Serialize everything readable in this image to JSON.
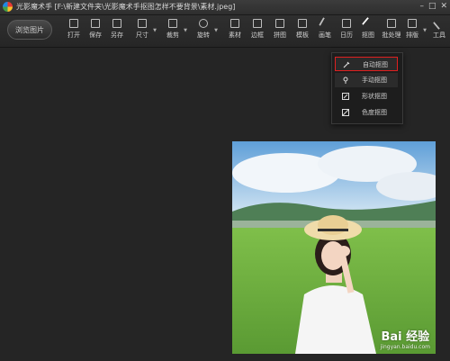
{
  "titlebar": {
    "title": "光影魔术手 [F:\\新建文件夹\\光影魔术手抠图怎样不要背景\\素材.jpeg]"
  },
  "toolbar": {
    "browse_label": "浏览图片",
    "tools": [
      {
        "label": "打开",
        "icon": "open-icon"
      },
      {
        "label": "保存",
        "icon": "save-icon"
      },
      {
        "label": "另存",
        "icon": "save-as-icon"
      },
      {
        "label": "尺寸",
        "icon": "resize-icon"
      },
      {
        "label": "裁剪",
        "icon": "crop-icon"
      },
      {
        "label": "旋转",
        "icon": "rotate-icon"
      },
      {
        "label": "素材",
        "icon": "material-icon"
      },
      {
        "label": "边框",
        "icon": "border-icon"
      },
      {
        "label": "拼图",
        "icon": "collage-icon"
      },
      {
        "label": "模板",
        "icon": "template-icon"
      },
      {
        "label": "画笔",
        "icon": "brush-icon"
      },
      {
        "label": "日历",
        "icon": "calendar-icon"
      },
      {
        "label": "抠图",
        "icon": "cutout-icon"
      },
      {
        "label": "批处理",
        "icon": "batch-icon"
      },
      {
        "label": "排版",
        "icon": "layout-icon"
      },
      {
        "label": "工具",
        "icon": "tools-icon"
      }
    ]
  },
  "cutout_menu": {
    "items": [
      {
        "label": "自动抠图",
        "icon": "auto-cutout-icon"
      },
      {
        "label": "手动抠图",
        "icon": "manual-cutout-icon"
      },
      {
        "label": "形状抠图",
        "icon": "shape-cutout-icon"
      },
      {
        "label": "色度抠图",
        "icon": "chroma-cutout-icon"
      }
    ]
  },
  "watermark": {
    "line1": "Bai 经验",
    "line2": "jingyan.baidu.com"
  },
  "colors": {
    "background": "#252525",
    "menu_highlight": "#e02020"
  }
}
